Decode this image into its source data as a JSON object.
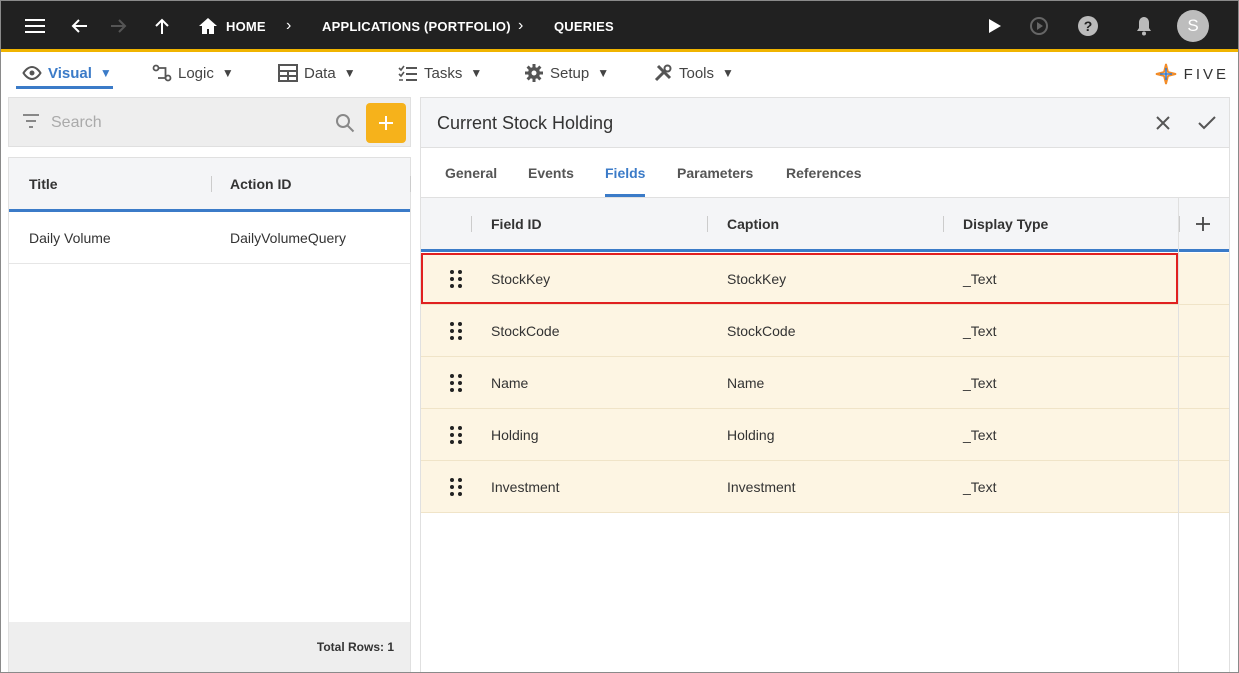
{
  "topbar": {
    "breadcrumbs": [
      "HOME",
      "APPLICATIONS (PORTFOLIO)",
      "QUERIES"
    ],
    "avatar_initial": "S"
  },
  "menu": {
    "items": [
      {
        "label": "Visual",
        "icon": "eye-icon"
      },
      {
        "label": "Logic",
        "icon": "logic-icon"
      },
      {
        "label": "Data",
        "icon": "table-icon"
      },
      {
        "label": "Tasks",
        "icon": "tasks-icon"
      },
      {
        "label": "Setup",
        "icon": "gear-icon"
      },
      {
        "label": "Tools",
        "icon": "tools-icon"
      }
    ],
    "arrow": "▼",
    "logo_text": "FIVE"
  },
  "left_panel": {
    "search_placeholder": "Search",
    "columns": [
      "Title",
      "Action ID"
    ],
    "rows": [
      {
        "title": "Daily Volume",
        "action_id": "DailyVolumeQuery"
      }
    ],
    "footer": "Total Rows: 1"
  },
  "right_panel": {
    "title": "Current Stock Holding",
    "tabs": [
      "General",
      "Events",
      "Fields",
      "Parameters",
      "References"
    ],
    "active_tab": "Fields",
    "columns": [
      "Field ID",
      "Caption",
      "Display Type"
    ],
    "rows": [
      {
        "field_id": "StockKey",
        "caption": "StockKey",
        "display_type": "_Text"
      },
      {
        "field_id": "StockCode",
        "caption": "StockCode",
        "display_type": "_Text"
      },
      {
        "field_id": "Name",
        "caption": "Name",
        "display_type": "_Text"
      },
      {
        "field_id": "Holding",
        "caption": "Holding",
        "display_type": "_Text"
      },
      {
        "field_id": "Investment",
        "caption": "Investment",
        "display_type": "_Text"
      }
    ]
  },
  "colors": {
    "accent": "#3b7bc8",
    "add_button": "#f6b21b",
    "topbar": "#212121",
    "row_highlight": "#fdf5e3",
    "selection_border": "#e02020"
  }
}
